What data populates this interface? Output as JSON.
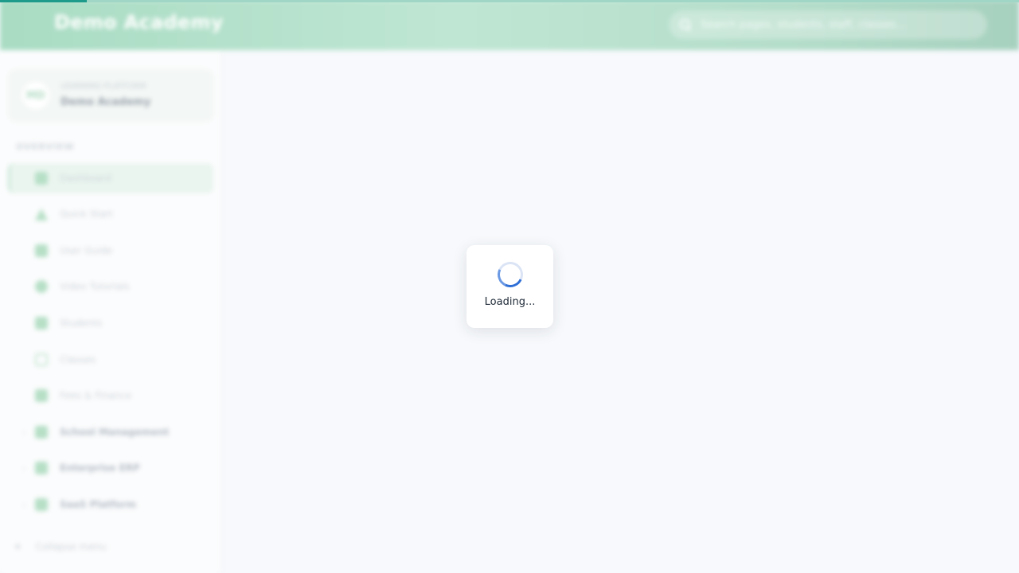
{
  "progress": {
    "fraction": 0.085
  },
  "header": {
    "title": "Demo Academy",
    "search_placeholder": "Search pages, students, staff, classes..."
  },
  "sidebar": {
    "school": {
      "logo_text": "MD",
      "tag": "LEARNING PLATFORM",
      "name": "Demo Academy"
    },
    "section_label": "OVERVIEW",
    "items": [
      {
        "label": "Dashboard",
        "icon": "home-icon"
      },
      {
        "label": "Quick Start",
        "icon": "rocket-icon"
      },
      {
        "label": "User Guide",
        "icon": "book-icon"
      },
      {
        "label": "Video Tutorials",
        "icon": "play-icon"
      },
      {
        "label": "Students",
        "icon": "student-icon"
      },
      {
        "label": "Classes",
        "icon": "classroom-icon"
      },
      {
        "label": "Fees & Finance",
        "icon": "finance-icon"
      },
      {
        "label": "School Management",
        "icon": "building-icon"
      },
      {
        "label": "Enterprise ERP",
        "icon": "enterprise-icon"
      },
      {
        "label": "SaaS Platform",
        "icon": "cloud-icon"
      }
    ],
    "collapse_icon": "«",
    "collapse_label": "Collapse menu"
  },
  "loading": {
    "text": "Loading..."
  },
  "colors": {
    "accent": "#1e9b8a",
    "spinner": "#2f6fd6"
  }
}
